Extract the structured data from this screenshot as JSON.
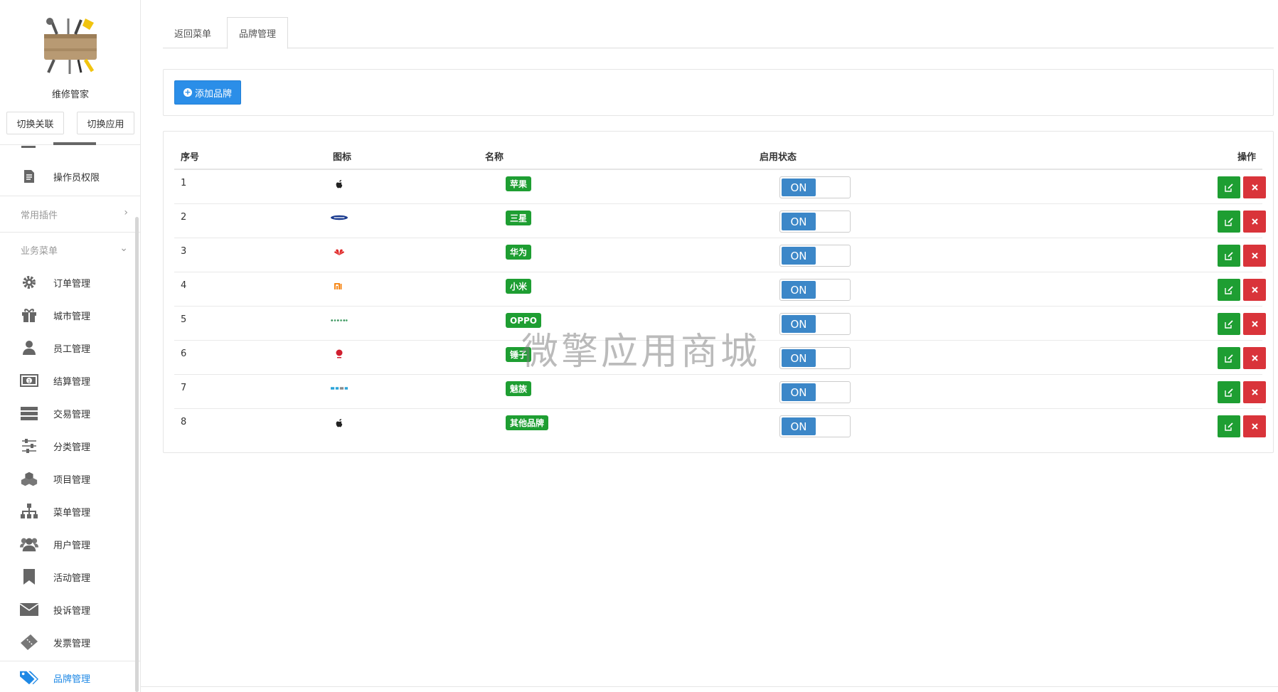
{
  "sidebar": {
    "app_name": "维修管家",
    "switch_link": "切换关联",
    "switch_app": "切换应用",
    "items_top": [
      {
        "label": "操作员权限",
        "icon": "document-icon"
      }
    ],
    "sections": [
      {
        "label": "常用插件",
        "chevron": "›"
      },
      {
        "label": "业务菜单",
        "chevron": "⌄"
      }
    ],
    "items": [
      {
        "label": "订单管理",
        "icon": "gear-icon"
      },
      {
        "label": "城市管理",
        "icon": "gift-icon"
      },
      {
        "label": "员工管理",
        "icon": "user-icon"
      },
      {
        "label": "结算管理",
        "icon": "money-icon"
      },
      {
        "label": "交易管理",
        "icon": "server-icon"
      },
      {
        "label": "分类管理",
        "icon": "sliders-icon"
      },
      {
        "label": "项目管理",
        "icon": "cubes-icon"
      },
      {
        "label": "菜单管理",
        "icon": "sitemap-icon"
      },
      {
        "label": "用户管理",
        "icon": "users-icon"
      },
      {
        "label": "活动管理",
        "icon": "bookmark-icon"
      },
      {
        "label": "投诉管理",
        "icon": "envelope-icon"
      },
      {
        "label": "发票管理",
        "icon": "ticket-icon"
      },
      {
        "label": "品牌管理",
        "icon": "tags-icon",
        "active": true
      }
    ]
  },
  "tabs": [
    {
      "label": "返回菜单"
    },
    {
      "label": "品牌管理",
      "active": true
    }
  ],
  "toolbar": {
    "add_label": "添加品牌"
  },
  "table": {
    "headers": {
      "index": "序号",
      "icon": "图标",
      "name": "名称",
      "status": "启用状态",
      "actions": "操作"
    },
    "rows": [
      {
        "index": "1",
        "name": "苹果",
        "icon": "apple-logo-icon",
        "status": "ON"
      },
      {
        "index": "2",
        "name": "三星",
        "icon": "samsung-logo-icon",
        "status": "ON"
      },
      {
        "index": "3",
        "name": "华为",
        "icon": "huawei-logo-icon",
        "status": "ON"
      },
      {
        "index": "4",
        "name": "小米",
        "icon": "xiaomi-logo-icon",
        "status": "ON"
      },
      {
        "index": "5",
        "name": "OPPO",
        "icon": "oppo-logo-icon",
        "status": "ON"
      },
      {
        "index": "6",
        "name": "锤子",
        "icon": "smartisan-logo-icon",
        "status": "ON"
      },
      {
        "index": "7",
        "name": "魅族",
        "icon": "meizu-logo-icon",
        "status": "ON"
      },
      {
        "index": "8",
        "name": "其他品牌",
        "icon": "apple-logo-icon",
        "status": "ON"
      }
    ]
  },
  "watermark": "微擎应用商城",
  "colors": {
    "primary": "#2b8ee8",
    "success": "#1e9e32",
    "danger": "#d9343a",
    "toggle_on": "#3c87c8"
  }
}
